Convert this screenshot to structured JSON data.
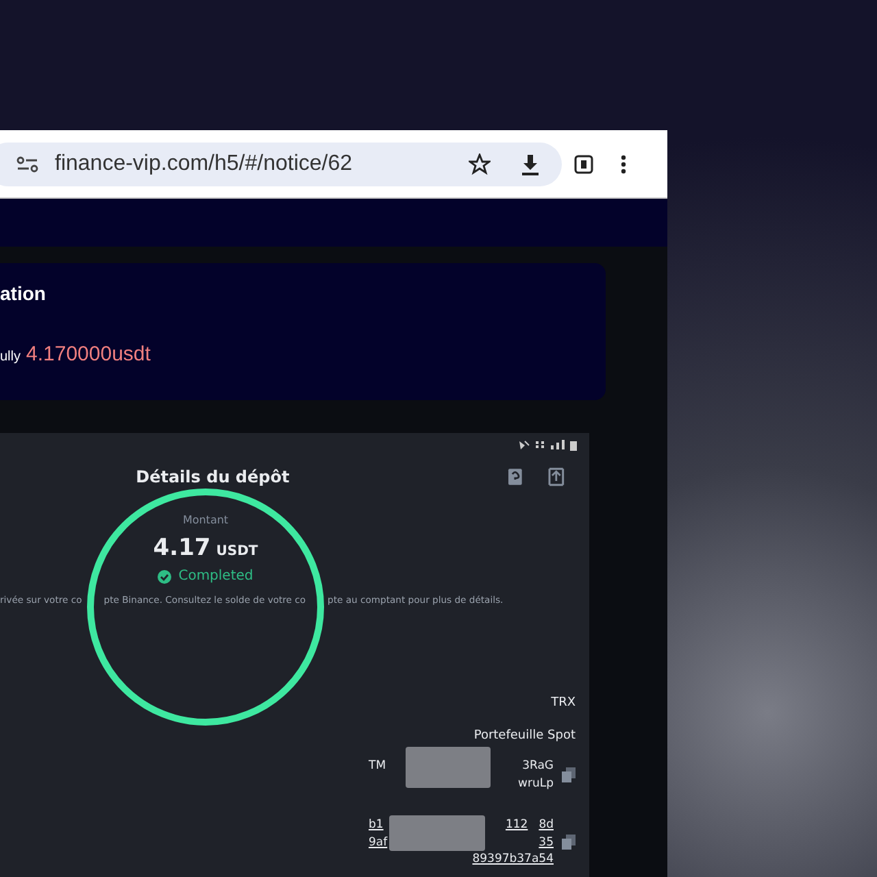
{
  "browser": {
    "url": "finance-vip.com/h5/#/notice/62"
  },
  "notice": {
    "title": "ation",
    "text": "ully",
    "amount": "4.170000usdt"
  },
  "deposit_screenshot": {
    "title": "Détails du dépôt",
    "amount_label": "Montant",
    "amount": "4.17",
    "currency": "USDT",
    "status": "Completed",
    "message_parts": [
      "rivée sur votre co",
      "pte Binance. Consultez le solde de votre co",
      "pte au comptant pour plus de détails."
    ],
    "network": "TRX",
    "wallet": "Portefeuille Spot",
    "address_parts": [
      "TM",
      "3RaG",
      "wruLp"
    ],
    "txid_parts": [
      "b1",
      "112",
      "8d",
      "9af",
      "35",
      "89397b37a54"
    ]
  }
}
